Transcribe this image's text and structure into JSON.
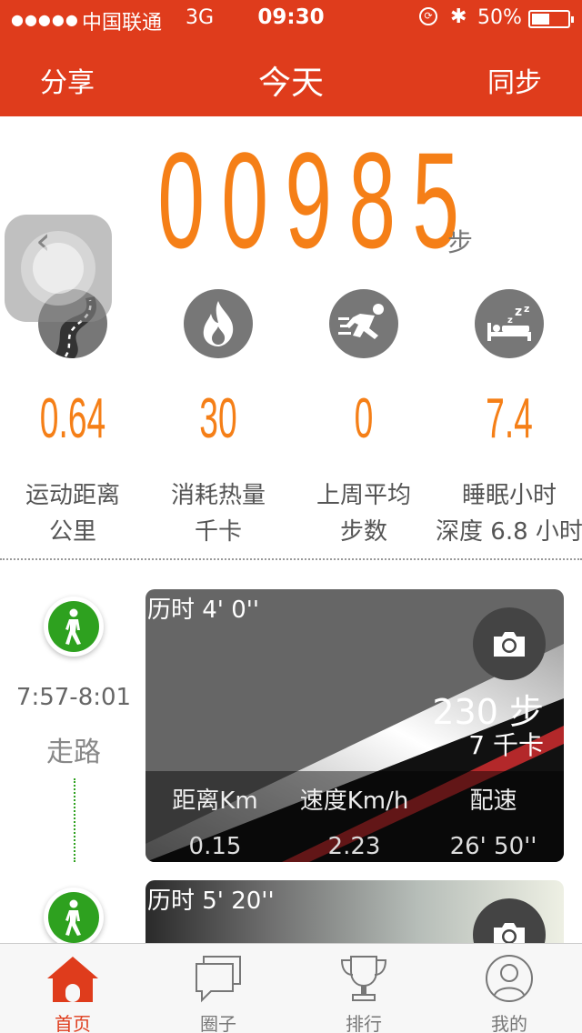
{
  "status_bar": {
    "signal": "●●●●●",
    "carrier": "中国联通",
    "network": "3G",
    "time": "09:30",
    "battery_percent": "50%",
    "battery_level": 0.5
  },
  "nav": {
    "share": "分享",
    "title": "今天",
    "sync": "同步"
  },
  "steps": {
    "digits": [
      "0",
      "0",
      "9",
      "8",
      "5"
    ],
    "unit": "步"
  },
  "stats": [
    {
      "icon": "road-icon",
      "value": "0.64",
      "label1": "运动距离",
      "label2": "公里"
    },
    {
      "icon": "flame-icon",
      "value": "30",
      "label1": "消耗热量",
      "label2": "千卡"
    },
    {
      "icon": "runner-icon",
      "value": "0",
      "label1": "上周平均",
      "label2": "步数"
    },
    {
      "icon": "sleep-icon",
      "value": "7.4",
      "label1": "睡眠小时",
      "label2": "深度 6.8 小时"
    }
  ],
  "activities": [
    {
      "duration": "历时 4' 0''",
      "timespan": "7:57-8:01",
      "type": "走路",
      "steps": "230 步",
      "kcal": "7 千卡",
      "headers": [
        "距离Km",
        "速度Km/h",
        "配速"
      ],
      "values": [
        "0.15",
        "2.23",
        "26' 50''"
      ]
    },
    {
      "duration": "历时 5' 20''"
    }
  ],
  "tabs": [
    {
      "icon": "home-icon",
      "label": "首页",
      "active": true
    },
    {
      "icon": "chat-icon",
      "label": "圈子",
      "active": false
    },
    {
      "icon": "trophy-icon",
      "label": "排行",
      "active": false
    },
    {
      "icon": "profile-icon",
      "label": "我的",
      "active": false
    }
  ],
  "colors": {
    "brand": "#df3c1c",
    "accent": "#f57f17",
    "walk": "#2ea11f"
  }
}
